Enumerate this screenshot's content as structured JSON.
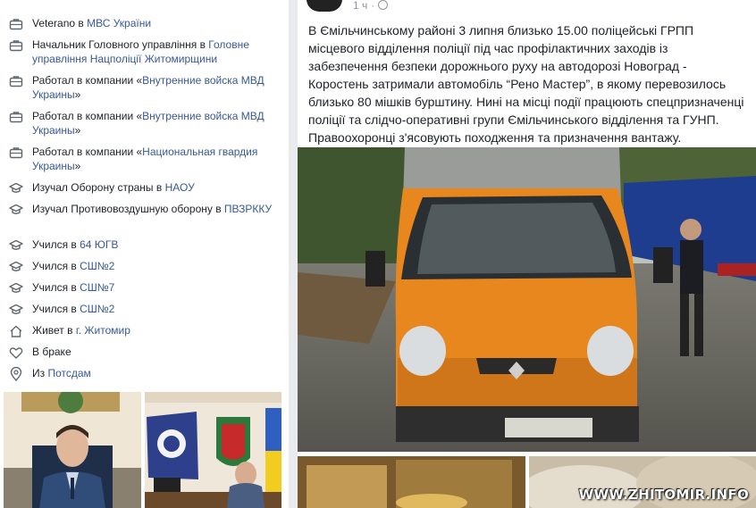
{
  "intro": [
    {
      "icon": "briefcase-icon",
      "prefix": "Veterano в ",
      "link": "МВС України",
      "suffix": ""
    },
    {
      "icon": "briefcase-icon",
      "prefix": "Начальник Головного управління в ",
      "link": "Головне управління Нацполіції Житомирщини",
      "suffix": ""
    },
    {
      "icon": "briefcase-icon",
      "prefix": "Работал в компании «",
      "link": "Внутренние войска МВД Украины",
      "suffix": "»"
    },
    {
      "icon": "briefcase-icon",
      "prefix": "Работал в компании «",
      "link": "Внутренние войска МВД Украины",
      "suffix": "»"
    },
    {
      "icon": "briefcase-icon",
      "prefix": "Работал в компании «",
      "link": "Национальная гвардия Украины",
      "suffix": "»"
    },
    {
      "icon": "graduation-cap-icon",
      "prefix": "Изучал Оборону страны в ",
      "link": "НАОУ",
      "suffix": ""
    },
    {
      "icon": "graduation-cap-icon",
      "prefix": "Изучал Противовоздушную оборону в ",
      "link": "ПВЗРККУ",
      "suffix": ""
    },
    {
      "icon": "graduation-cap-icon",
      "prefix": "Учился в ",
      "link": "64 ЮГВ",
      "suffix": ""
    },
    {
      "icon": "graduation-cap-icon",
      "prefix": "Учился в ",
      "link": "СШ№2",
      "suffix": ""
    },
    {
      "icon": "graduation-cap-icon",
      "prefix": "Учился в ",
      "link": "СШ№7",
      "suffix": ""
    },
    {
      "icon": "graduation-cap-icon",
      "prefix": "Учился в ",
      "link": "СШ№2",
      "suffix": ""
    },
    {
      "icon": "home-icon",
      "prefix": "Живет в ",
      "link": "г. Житомир",
      "suffix": ""
    },
    {
      "icon": "heart-icon",
      "prefix": "В браке",
      "link": "",
      "suffix": ""
    },
    {
      "icon": "location-pin-icon",
      "prefix": "Из ",
      "link": "Потсдам",
      "suffix": ""
    }
  ],
  "post": {
    "time": "1 ч",
    "separator": "·",
    "text": "В Ємільчинському районі 3 липня близько 15.00 поліцейські ГРПП місцевого відділення поліції під час профілактичних заходів із забезпечення безпеки дорожнього руху на автодорозі Новоград - Коростень затримали автомобіль “Рено Мастер”, в якому перевозилось близько 80 мішків бурштину. Нині на місці події працюють спецпризначенці поліції та слідчо-оперативні групи Ємільчинського відділення та ГУНП. Правоохоронці з'ясовують походження та призначення вантажу.",
    "watermark": "WWW.ZHITOMIR.INFO"
  },
  "colors": {
    "link": "#385898",
    "text": "#1d2129",
    "meta": "#90949c",
    "van": "#e8871e"
  }
}
